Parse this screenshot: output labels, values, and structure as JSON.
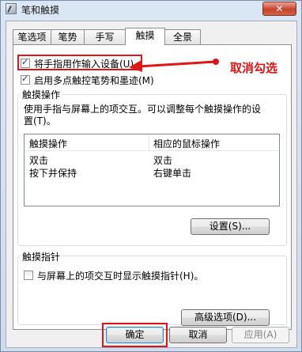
{
  "window": {
    "title": "笔和触摸",
    "close_symbol": "✕"
  },
  "tabs": [
    {
      "label": "笔选项",
      "active": false
    },
    {
      "label": "笔势",
      "active": false
    },
    {
      "label": "手写",
      "active": false
    },
    {
      "label": "触摸",
      "active": true
    },
    {
      "label": "全景",
      "active": false
    }
  ],
  "touch": {
    "use_finger_label": "将手指用作输入设备(U)",
    "use_finger_checked": true,
    "multitouch_label": "启用多点触控笔势和墨迹(M)",
    "multitouch_checked": true
  },
  "touch_actions": {
    "title": "触摸操作",
    "description": "使用手指与屏幕上的项交互。可以调整每个触摸操作的设置(T)。",
    "columns": [
      "触摸操作",
      "相应的鼠标操作"
    ],
    "rows": [
      [
        "双击",
        "双击"
      ],
      [
        "按下并保持",
        "右键单击"
      ]
    ],
    "settings_button": "设置(S)..."
  },
  "touch_pointer": {
    "title": "触摸指针",
    "show_pointer_label": "与屏幕上的项交互时显示触摸指针(H)。",
    "show_pointer_checked": false,
    "advanced_button": "高级选项(D)..."
  },
  "footer": {
    "ok": "确定",
    "cancel": "取消",
    "apply": "应用(A)"
  },
  "annotation": {
    "text": "取消勾选",
    "color": "#e01515"
  }
}
